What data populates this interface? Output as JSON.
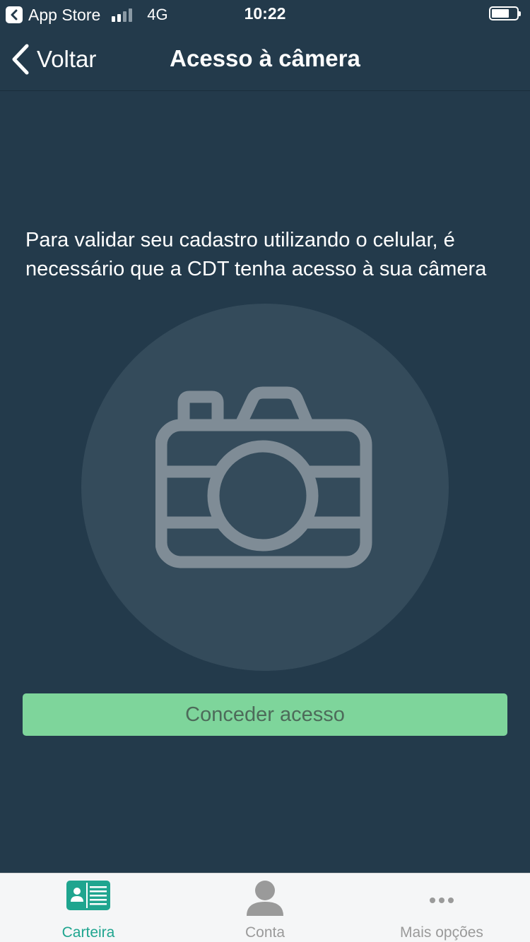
{
  "status_bar": {
    "back_app_label": "App Store",
    "network": "4G",
    "time": "10:22",
    "signal_bars_filled": 2,
    "signal_bars_total": 4,
    "battery_level": 0.7
  },
  "nav": {
    "back_label": "Voltar",
    "title": "Acesso à câmera"
  },
  "content": {
    "message": "Para validar seu cadastro utilizando o celular, é necessário que a CDT tenha acesso à sua câmera",
    "icon": "camera-icon",
    "button_label": "Conceder acesso"
  },
  "tabs": [
    {
      "label": "Carteira",
      "icon": "wallet-card-icon",
      "active": true
    },
    {
      "label": "Conta",
      "icon": "user-icon",
      "active": false
    },
    {
      "label": "Mais opções",
      "icon": "more-dots-icon",
      "active": false
    }
  ],
  "colors": {
    "background": "#233a4b",
    "circle": "#344b5b",
    "icon_gray": "#7f8c96",
    "button": "#7ed59b",
    "button_text": "#4d6b5a",
    "tab_active": "#1fa58f",
    "tab_inactive": "#9a9a9a"
  }
}
